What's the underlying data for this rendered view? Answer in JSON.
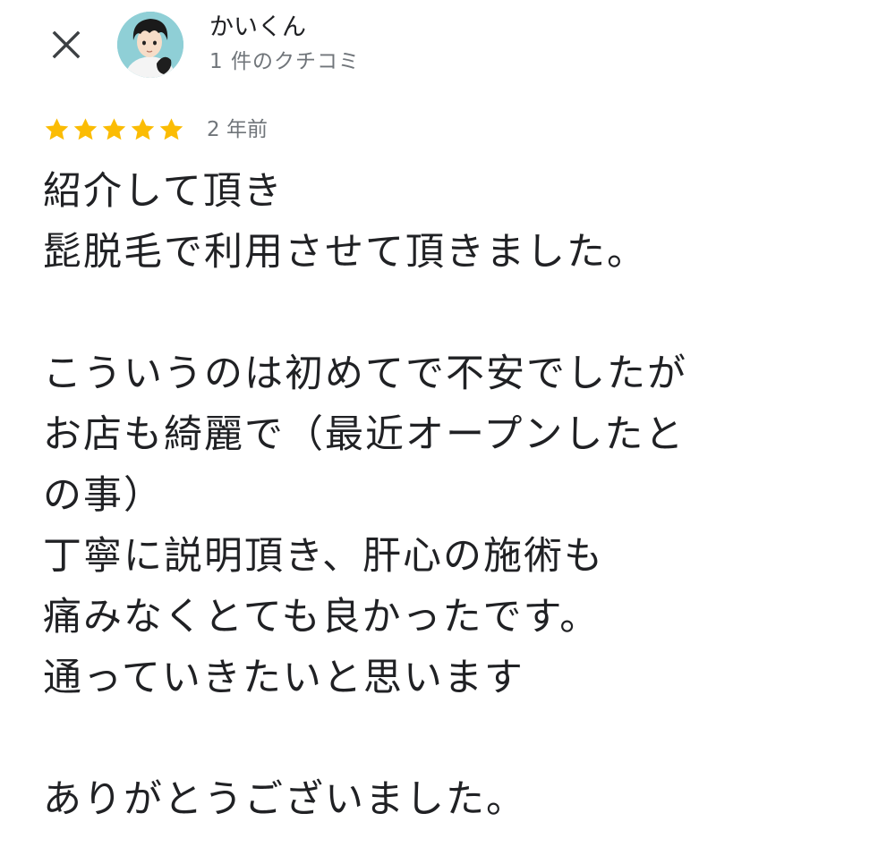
{
  "header": {
    "close_icon": "close-icon",
    "author": {
      "name": "かいくん",
      "review_count": "1 件のクチコミ",
      "avatar_icon": "avatar-anime-portrait"
    }
  },
  "review": {
    "rating": 5,
    "max_rating": 5,
    "star_color": "#fbbc04",
    "date": "2 年前",
    "text": "紹介して頂き\n髭脱毛で利用させて頂きました。\n\nこういうのは初めてで不安でしたが\nお店も綺麗で（最近オープンしたと\nの事）\n丁寧に説明頂き、肝心の施術も\n痛みなくとても良かったです。\n通っていきたいと思います\n\nありがとうございました。"
  }
}
